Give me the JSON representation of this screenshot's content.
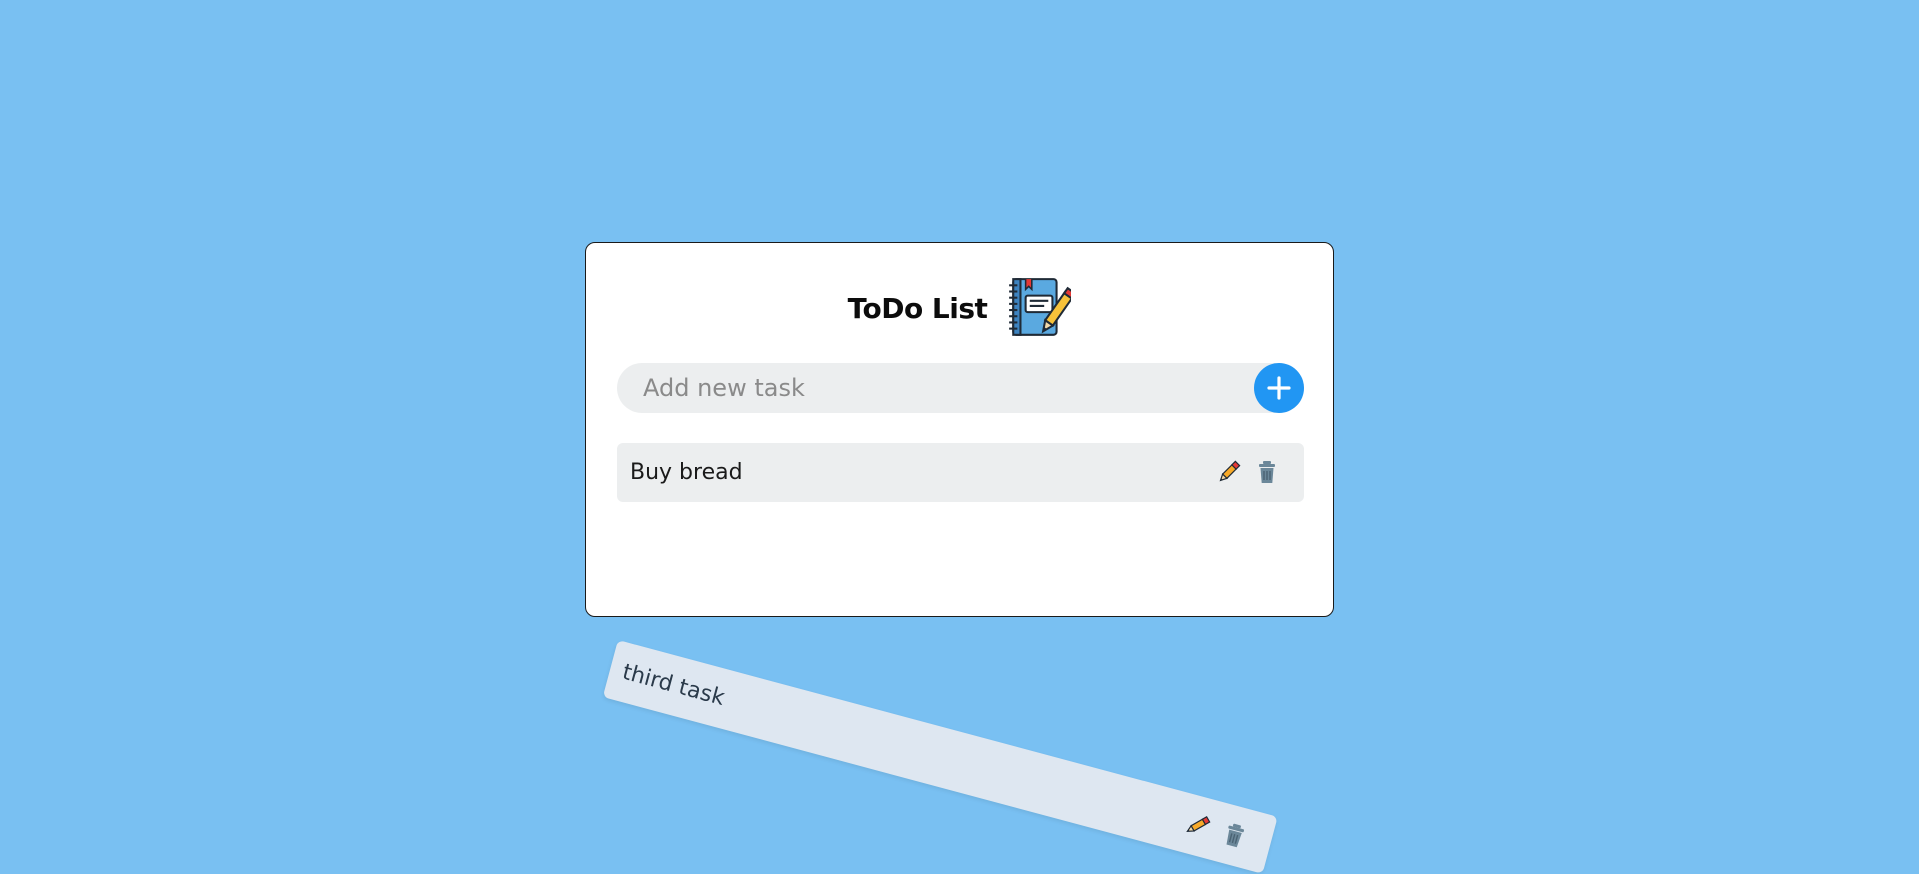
{
  "app": {
    "title": "ToDo List",
    "title_icon": "notebook-pencil-icon"
  },
  "add": {
    "placeholder": "Add new task",
    "value": "",
    "button_icon": "plus-icon"
  },
  "tasks": [
    {
      "text": "Buy bread",
      "edit_icon": "pencil-icon",
      "delete_icon": "trash-icon"
    }
  ],
  "dragging": {
    "text": "third task",
    "edit_icon": "pencil-icon",
    "delete_icon": "trash-icon"
  },
  "colors": {
    "background": "#79c0f2",
    "card": "#ffffff",
    "accent": "#2196f3",
    "task_bg": "#eceeef",
    "drag_bg": "#dee7f1"
  }
}
